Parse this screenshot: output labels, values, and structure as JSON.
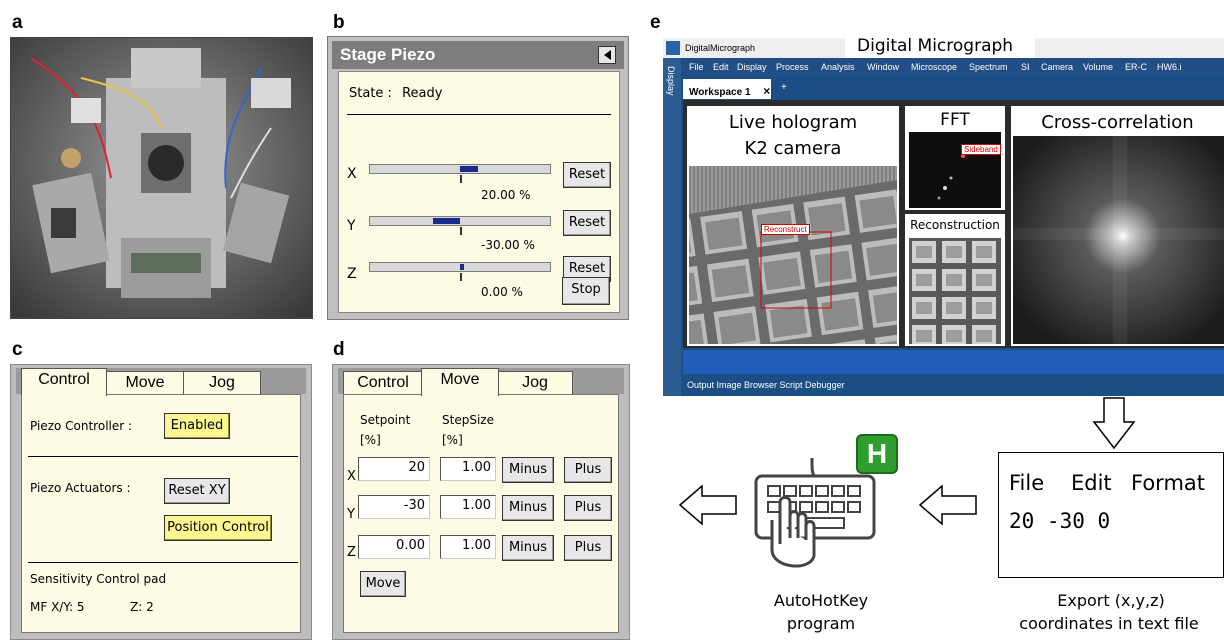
{
  "letters": {
    "a": "a",
    "b": "b",
    "c": "c",
    "d": "d",
    "e": "e"
  },
  "stage_piezo": {
    "title": "Stage Piezo",
    "state_label": "State :",
    "state_value": "Ready",
    "axes": [
      {
        "label": "X",
        "value_text": "20.00 %",
        "value": 20,
        "reset": "Reset"
      },
      {
        "label": "Y",
        "value_text": "-30.00 %",
        "value": -30,
        "reset": "Reset"
      },
      {
        "label": "Z",
        "value_text": "0.00 %",
        "value": 0,
        "reset": "Reset"
      }
    ],
    "stop": "Stop"
  },
  "control_panel": {
    "tabs": [
      "Control",
      "Move",
      "Jog"
    ],
    "piezo_controller_label": "Piezo Controller :",
    "enabled": "Enabled",
    "piezo_actuators_label": "Piezo Actuators :",
    "reset_xy": "Reset XY",
    "position_control": "Position Control",
    "sensitivity_title": "Sensitivity Control pad",
    "mf_xy": "MF X/Y:  5",
    "mf_z": "Z: 2"
  },
  "move_panel": {
    "tabs": [
      "Control",
      "Move",
      "Jog"
    ],
    "setpoint_header": "Setpoint",
    "setpoint_unit": "[%]",
    "stepsize_header": "StepSize",
    "stepsize_unit": "[%]",
    "rows": [
      {
        "axis": "X",
        "setpoint": "20",
        "step": "1.00",
        "minus": "Minus",
        "plus": "Plus"
      },
      {
        "axis": "Y",
        "setpoint": "-30",
        "step": "1.00",
        "minus": "Minus",
        "plus": "Plus"
      },
      {
        "axis": "Z",
        "setpoint": "0.00",
        "step": "1.00",
        "minus": "Minus",
        "plus": "Plus"
      }
    ],
    "move": "Move"
  },
  "digital_micrograph": {
    "app_name": "DigitalMicrograph",
    "heading": "Digital Micrograph",
    "menu": [
      "File",
      "Edit",
      "Display",
      "Process",
      "Analysis",
      "Window",
      "Microscope",
      "Spectrum",
      "SI",
      "Camera",
      "Volume",
      "ER-C",
      "HW6.i"
    ],
    "side_label": "Display",
    "workspace_tab": "Workspace 1",
    "tab_close": "×",
    "tab_add": "+",
    "live_title_1": "Live hologram",
    "live_title_2": "K2 camera",
    "reconstruct_label": "Reconstruct",
    "fft_title": "FFT",
    "sideband_label": "Sideband",
    "reconstruction_title": "Reconstruction",
    "crosscorr_title": "Cross-correlation",
    "status_items": "Output  Image Browser  Script Debugger"
  },
  "notepad": {
    "menu": [
      "File",
      "Edit",
      "Format"
    ],
    "content": "20 -30 0"
  },
  "captions": {
    "export_1": "Export (x,y,z)",
    "export_2": "coordinates in text file",
    "ahk_1": "AutoHotKey",
    "ahk_2": "program",
    "ahk_badge": "H"
  },
  "colors": {
    "panel_yellow": "#fdfbe4",
    "button_yellow": "#fbf68f",
    "dm_blue": "#1b4e84",
    "slider_fill": "#1b2b8c",
    "ahk_green": "#2f9e2f"
  }
}
